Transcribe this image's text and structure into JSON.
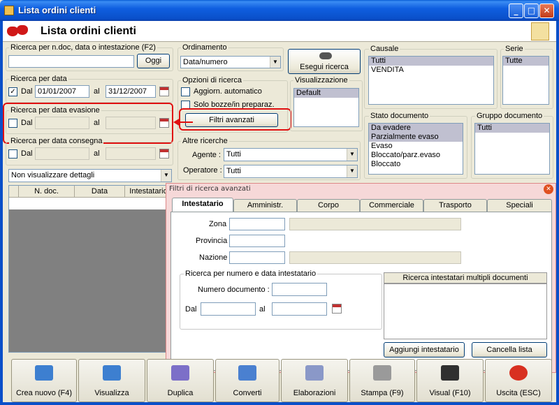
{
  "window": {
    "title": "Lista ordini clienti"
  },
  "header": {
    "title": "Lista ordini clienti"
  },
  "ricerca": {
    "label": "Ricerca per n.doc, data o intestazione (F2)",
    "value": "",
    "oggi_label": "Oggi"
  },
  "ordinamento": {
    "label": "Ordinamento",
    "value": "Data/numero"
  },
  "esegui_label": "Esegui ricerca",
  "causale": {
    "label": "Causale",
    "items": [
      "Tutti",
      "VENDITA"
    ]
  },
  "serie": {
    "label": "Serie",
    "items": [
      "Tutte"
    ]
  },
  "ricerca_data": {
    "label": "Ricerca per data",
    "dal_label": "Dal",
    "dal_value": "01/01/2007",
    "al_label": "al",
    "al_value": "31/12/2007",
    "checked": true
  },
  "ricerca_evasione": {
    "label": "Ricerca per data evasione",
    "dal_label": "Dal",
    "al_label": "al"
  },
  "ricerca_consegna": {
    "label": "Ricerca per data consegna",
    "dal_label": "Dal",
    "al_label": "al"
  },
  "opzioni": {
    "label": "Opzioni di ricerca",
    "aggiorn_label": "Aggiorn. automatico",
    "bozze_label": "Solo bozze/in preparaz.",
    "filtri_label": "Filtri avanzati"
  },
  "visualizzazione": {
    "label": "Visualizzazione",
    "items": [
      "Default"
    ]
  },
  "stato": {
    "label": "Stato documento",
    "items": [
      "Da evadere",
      "Parzialmente evaso",
      "Evaso",
      "Bloccato/parz.evaso",
      "Bloccato"
    ]
  },
  "gruppo": {
    "label": "Gruppo documento",
    "items": [
      "Tutti"
    ]
  },
  "altre": {
    "label": "Altre ricerche",
    "agente_label": "Agente :",
    "agente_value": "Tutti",
    "operatore_label": "Operatore :",
    "operatore_value": "Tutti"
  },
  "dettagli": {
    "value": "Non visualizzare dettagli"
  },
  "grid": {
    "columns": [
      "N. doc.",
      "Data",
      "Intestatario"
    ]
  },
  "filtri_dialog": {
    "title": "Filtri di ricerca avanzati",
    "tabs": [
      "Intestatario",
      "Amministr.",
      "Corpo",
      "Commerciale",
      "Trasporto",
      "Speciali"
    ],
    "zona_label": "Zona",
    "provincia_label": "Provincia",
    "nazione_label": "Nazione",
    "numero_group_label": "Ricerca per numero e data intestatario",
    "numero_doc_label": "Numero documento :",
    "dal_label": "Dal",
    "al_label": "al",
    "multipli_label": "Ricerca intestatari multipli documenti",
    "aggiungi_label": "Aggiungi intestatario",
    "cancella_label": "Cancella lista"
  },
  "bottom_buttons": [
    {
      "label": "Crea nuovo (F4)",
      "icon": "folder-plus-icon",
      "color": "#3d7fd0"
    },
    {
      "label": "Visualizza",
      "icon": "folder-search-icon",
      "color": "#3d7fd0"
    },
    {
      "label": "Duplica",
      "icon": "duplicate-icon",
      "color": "#7c6fc8"
    },
    {
      "label": "Converti",
      "icon": "convert-icon",
      "color": "#4a80d0"
    },
    {
      "label": "Elaborazioni",
      "icon": "gear-icon",
      "color": "#8a98c8"
    },
    {
      "label": "Stampa (F9)",
      "icon": "printer-icon",
      "color": "#9a9a9a"
    },
    {
      "label": "Visual (F10)",
      "icon": "pen-icon",
      "color": "#303030"
    },
    {
      "label": "Uscita (ESC)",
      "icon": "exit-icon",
      "color": "#d83020"
    }
  ],
  "colors": {
    "accent": "#0a4fc9",
    "highlight": "#e01010",
    "dialog_bg": "#f6d8d8"
  }
}
